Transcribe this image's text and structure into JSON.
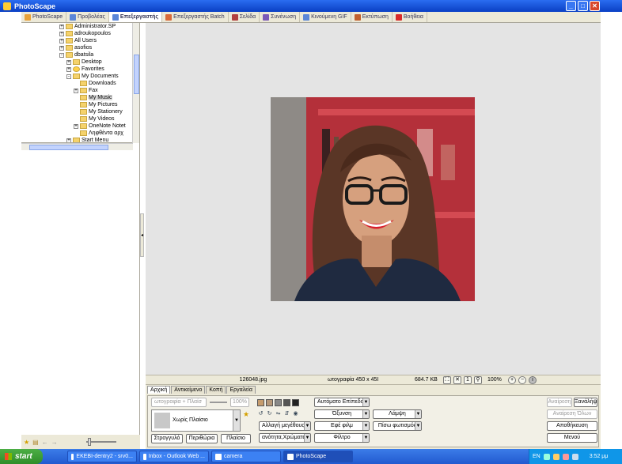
{
  "window": {
    "title": "PhotoScape",
    "buttons": [
      "_",
      "□",
      "✕"
    ]
  },
  "tabs": [
    {
      "label": "PhotoScape",
      "icon": "photoscape-icon",
      "active": false,
      "color": "#e8a23a"
    },
    {
      "label": "Προβολέας",
      "icon": "viewer-icon",
      "active": false,
      "color": "#5a86d8"
    },
    {
      "label": "Επεξεργαστής",
      "icon": "editor-icon",
      "active": true,
      "color": "#5a86d8"
    },
    {
      "label": "Επεξεργαστής Batch",
      "icon": "batch-icon",
      "active": false,
      "color": "#d86a3a"
    },
    {
      "label": "Σελίδα",
      "icon": "page-icon",
      "active": false,
      "color": "#b04040"
    },
    {
      "label": "Συνένωση",
      "icon": "combine-icon",
      "active": false,
      "color": "#7a5ab8"
    },
    {
      "label": "Κινούμενη GIF",
      "icon": "gif-icon",
      "active": false,
      "color": "#5a86d8"
    },
    {
      "label": "Εκτύπωση",
      "icon": "print-icon",
      "active": false,
      "color": "#c0602e"
    },
    {
      "label": "Βοήθεια",
      "icon": "help-icon",
      "active": false,
      "color": "#d82a2a"
    }
  ],
  "tree": [
    {
      "label": "Administrator.SP",
      "depth": 0,
      "exp": "+",
      "selected": false
    },
    {
      "label": "adroukopoulos",
      "depth": 0,
      "exp": "+",
      "selected": false
    },
    {
      "label": "All Users",
      "depth": 0,
      "exp": "+",
      "selected": false
    },
    {
      "label": "asofios",
      "depth": 0,
      "exp": "+",
      "selected": false
    },
    {
      "label": "dbatsila",
      "depth": 0,
      "exp": "-",
      "selected": false
    },
    {
      "label": "Desktop",
      "depth": 1,
      "exp": "+",
      "selected": false
    },
    {
      "label": "Favorites",
      "depth": 1,
      "exp": "+",
      "selected": false
    },
    {
      "label": "My Documents",
      "depth": 1,
      "exp": "-",
      "selected": false
    },
    {
      "label": "Downloads",
      "depth": 2,
      "exp": "",
      "selected": false
    },
    {
      "label": "Fax",
      "depth": 2,
      "exp": "+",
      "selected": false
    },
    {
      "label": "My Music",
      "depth": 2,
      "exp": "",
      "selected": true
    },
    {
      "label": "My Pictures",
      "depth": 2,
      "exp": "",
      "selected": false
    },
    {
      "label": "My Stationery",
      "depth": 2,
      "exp": "",
      "selected": false
    },
    {
      "label": "My Videos",
      "depth": 2,
      "exp": "",
      "selected": false
    },
    {
      "label": "OneNote Notet",
      "depth": 2,
      "exp": "+",
      "selected": false
    },
    {
      "label": "Ληφθέντα αρχ",
      "depth": 2,
      "exp": "",
      "selected": false
    },
    {
      "label": "Start Menu",
      "depth": 1,
      "exp": "+",
      "selected": false
    }
  ],
  "status": {
    "filename": "126048.jpg",
    "dimensions": "ωτογραφία 450 x 45I",
    "filesize": "684.7 KB",
    "zoom": "100%"
  },
  "editor_tabs": [
    "Αρχική",
    "Αντικείμενο",
    "Κοπή",
    "Εργαλεία"
  ],
  "editor": {
    "frame_combo": "ωτογραφία + Πλαίσ",
    "frame_pct": "100%",
    "frame_name": "Χωρίς Πλαίσιο",
    "btn_round": "Στρογγυλό",
    "btn_margin": "Περιθώρια",
    "btn_frame": "Πλαίσιο",
    "auto_level": "Αυτόματο Επίπεδο",
    "sharpen": "Όξυνση",
    "resize": "Αλλαγή μεγέθους",
    "bright": "Εφέ φιλμ",
    "color": "ανότητα,Χρώματα",
    "filter": "Φίλτρο",
    "bloom": "Λάμψη",
    "backlight": "Πίσω φωτισμός",
    "undo": "Αναίρεση",
    "redo": "Ξανάλήψ",
    "undo_all": "Αναίρεση Όλων",
    "save": "Αποθήκευση",
    "menu": "Μενού"
  },
  "taskbar": {
    "start": "start",
    "items": [
      {
        "label": "ΕΚΕΒΙ-dentry2 - srv0...",
        "active": false
      },
      {
        "label": "Inbox - Outlook Web ...",
        "active": false
      },
      {
        "label": "camera",
        "active": false
      },
      {
        "label": "PhotoScape",
        "active": true
      }
    ],
    "lang": "EN",
    "time": "3:52 μμ"
  }
}
